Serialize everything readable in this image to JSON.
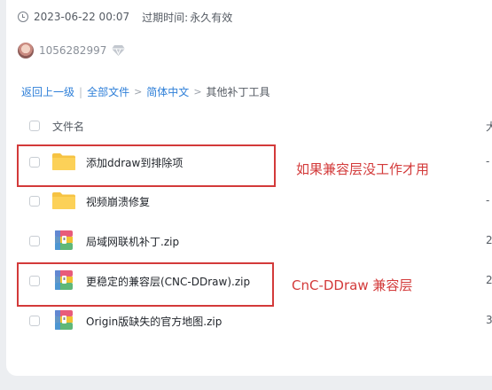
{
  "meta": {
    "date": "2023-06-22 00:07",
    "expire_label": "过期时间:",
    "expire_value": "永久有效"
  },
  "user": {
    "id": "1056282997"
  },
  "breadcrumb": {
    "back": "返回上一级",
    "separator": "|",
    "all_files": "全部文件",
    "simplified_chinese": "简体中文",
    "current": "其他补丁工具"
  },
  "table": {
    "header_name": "文件名",
    "header_size_partial": "大",
    "rows": [
      {
        "name": "添加ddraw到排除项",
        "type": "folder",
        "size": "-"
      },
      {
        "name": "视频崩溃修复",
        "type": "folder",
        "size": "-"
      },
      {
        "name": "局域网联机补丁.zip",
        "type": "zip",
        "size": "2"
      },
      {
        "name": "更稳定的兼容层(CNC-DDraw).zip",
        "type": "zip",
        "size": "2"
      },
      {
        "name": "Origin版缺失的官方地图.zip",
        "type": "zip",
        "size": "3"
      }
    ]
  },
  "annotations": {
    "note1": "如果兼容层没工作才用",
    "note2": "CnC-DDraw 兼容层",
    "color": "#d33a3a"
  }
}
